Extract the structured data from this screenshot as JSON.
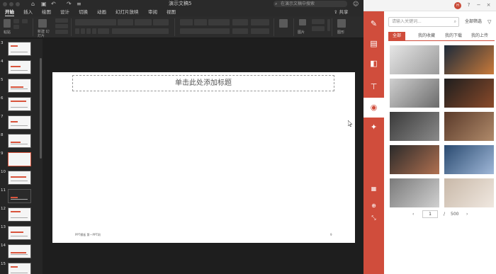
{
  "window": {
    "title": "演示文稿5",
    "search_placeholder": "在演示文稿中搜索"
  },
  "menu": {
    "tabs": [
      "开始",
      "插入",
      "绘图",
      "设计",
      "切换",
      "动画",
      "幻灯片放映",
      "审阅",
      "视图"
    ],
    "active_tab": "开始",
    "share_label": "共享"
  },
  "ribbon": {
    "paste_label": "粘贴",
    "new_slide_label": "新建\n幻灯片",
    "picture_label": "图片",
    "icon_label": "图形"
  },
  "thumbnails": {
    "numbers": [
      "3",
      "4",
      "5",
      "6",
      "7",
      "8",
      "9",
      "10",
      "11",
      "12",
      "13",
      "14",
      "15"
    ],
    "selected": "9"
  },
  "slide": {
    "title_placeholder": "单击此处添加标题",
    "footer_text": "PPT模板 第一PPT网",
    "page_number": "9"
  },
  "addin": {
    "avatar_text": "H",
    "search_placeholder": "请输入关键词...",
    "filter_label": "全部筛选",
    "tabs": [
      "全部",
      "我的收藏",
      "我的下载",
      "我的上传"
    ],
    "active_tab": "全部",
    "pager": {
      "current": "1",
      "separator": "/",
      "total": "500",
      "prev": "‹",
      "next": "›"
    },
    "images": [
      {
        "name": "laptop-desk",
        "c1": "#e6e6e6",
        "c2": "#9a9a9a"
      },
      {
        "name": "light-trails",
        "c1": "#1c2a3a",
        "c2": "#c97a3a"
      },
      {
        "name": "typing-hands",
        "c1": "#cfcfcf",
        "c2": "#6b6b6b"
      },
      {
        "name": "dark-desk",
        "c1": "#1e1e1e",
        "c2": "#8a4a2a"
      },
      {
        "name": "mountain-road",
        "c1": "#3a3a3a",
        "c2": "#8a8a8a"
      },
      {
        "name": "tablet-table",
        "c1": "#5a3a2a",
        "c2": "#b08a6a"
      },
      {
        "name": "coffee-cup",
        "c1": "#2a2a2a",
        "c2": "#b07050"
      },
      {
        "name": "ocean-horizon",
        "c1": "#2a4a70",
        "c2": "#a0b8d8"
      },
      {
        "name": "skyscraper",
        "c1": "#7a7a7a",
        "c2": "#d0d0d0"
      },
      {
        "name": "cafe-window",
        "c1": "#c8b8a8",
        "c2": "#f0e8e0"
      }
    ]
  },
  "icons": {
    "nav": [
      "note-icon",
      "list-icon",
      "shapes-icon",
      "org-chart-icon",
      "photo-icon",
      "brush-icon"
    ],
    "nav_bottom": [
      "layout-icon",
      "globe-icon"
    ]
  }
}
